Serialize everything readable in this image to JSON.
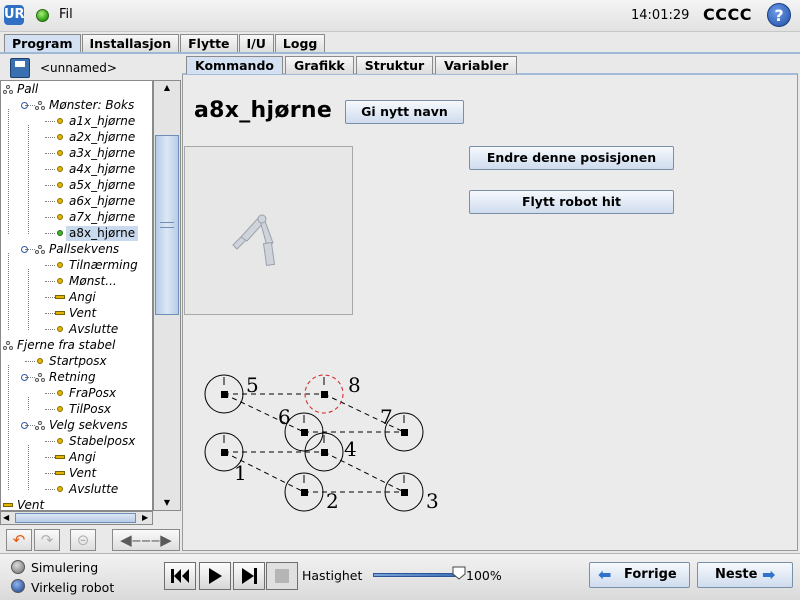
{
  "header": {
    "logo_text": "UR",
    "file_menu": "Fil",
    "time": "14:01:29",
    "robot_name": "CCCC",
    "help_label": "?"
  },
  "main_tabs": [
    {
      "label": "Program",
      "active": true
    },
    {
      "label": "Installasjon"
    },
    {
      "label": "Flytte"
    },
    {
      "label": "I/U"
    },
    {
      "label": "Logg"
    }
  ],
  "program": {
    "filename": "<unnamed>"
  },
  "tree": {
    "items": [
      {
        "label": "Pall",
        "icon": "node-icon"
      },
      {
        "label": "Mønster: Boks",
        "icon": "node-icon"
      },
      {
        "label": "a1x_hjørne",
        "icon": "waypoint-icon"
      },
      {
        "label": "a2x_hjørne",
        "icon": "waypoint-icon"
      },
      {
        "label": "a3x_hjørne",
        "icon": "waypoint-icon"
      },
      {
        "label": "a4x_hjørne",
        "icon": "waypoint-icon"
      },
      {
        "label": "a5x_hjørne",
        "icon": "waypoint-icon"
      },
      {
        "label": "a6x_hjørne",
        "icon": "waypoint-icon"
      },
      {
        "label": "a7x_hjørne",
        "icon": "waypoint-icon"
      },
      {
        "label": "a8x_hjørne",
        "icon": "waypoint-icon",
        "selected": true
      },
      {
        "label": "Pallsekvens",
        "icon": "node-icon"
      },
      {
        "label": "Tilnærming",
        "icon": "waypoint-icon"
      },
      {
        "label": "Mønst...",
        "icon": "waypoint-icon"
      },
      {
        "label": "Angi",
        "icon": "set-icon"
      },
      {
        "label": "Vent",
        "icon": "wait-icon"
      },
      {
        "label": "Avslutte",
        "icon": "waypoint-icon"
      },
      {
        "label": "Fjerne fra stabel",
        "icon": "node-icon"
      },
      {
        "label": "Startposx",
        "icon": "waypoint-icon"
      },
      {
        "label": "Retning",
        "icon": "node-icon"
      },
      {
        "label": "FraPosx",
        "icon": "waypoint-icon"
      },
      {
        "label": "TilPosx",
        "icon": "waypoint-icon"
      },
      {
        "label": "Velg sekvens",
        "icon": "node-icon"
      },
      {
        "label": "Stabelposx",
        "icon": "waypoint-icon"
      },
      {
        "label": "Angi",
        "icon": "set-icon"
      },
      {
        "label": "Vent",
        "icon": "wait-icon"
      },
      {
        "label": "Avslutte",
        "icon": "waypoint-icon"
      },
      {
        "label": "Vent",
        "icon": "wait-icon"
      }
    ]
  },
  "content_tabs": [
    {
      "label": "Kommando",
      "active": true
    },
    {
      "label": "Grafikk"
    },
    {
      "label": "Struktur"
    },
    {
      "label": "Variabler"
    }
  ],
  "waypoint": {
    "name": "a8x_hjørne",
    "rename_button": "Gi nytt navn",
    "change_position_button": "Endre denne posisjonen",
    "move_robot_button": "Flytt robot hit"
  },
  "pattern_diagram": {
    "labels": [
      "1",
      "2",
      "3",
      "4",
      "5",
      "6",
      "7",
      "8"
    ],
    "highlighted": "8"
  },
  "footer": {
    "simulation_label": "Simulering",
    "real_robot_label": "Virkelig robot",
    "speed_label": "Hastighet",
    "speed_value": "100%",
    "speed_fraction": 1.0,
    "prev_button": "Forrige",
    "next_button": "Neste"
  },
  "colors": {
    "accent": "#2f73cc",
    "selected_row": "#c9d9ee",
    "waypoint": "#e0b600",
    "highlight_circle": "#d42020"
  }
}
